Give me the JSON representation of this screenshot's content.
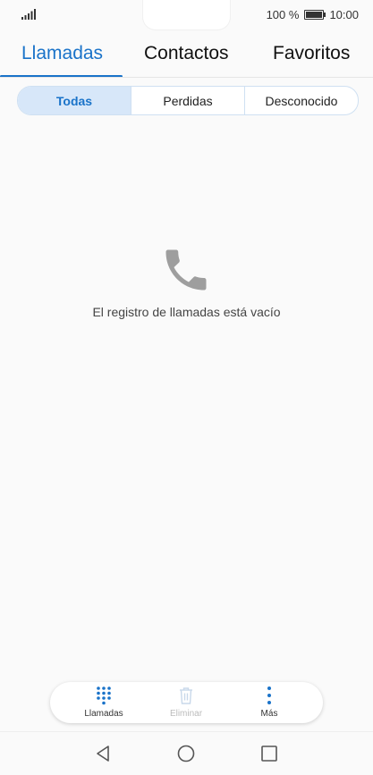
{
  "status": {
    "battery_percent": "100 %",
    "time": "10:00"
  },
  "tabs": [
    {
      "label": "Llamadas",
      "active": true
    },
    {
      "label": "Contactos",
      "active": false
    },
    {
      "label": "Favoritos",
      "active": false
    }
  ],
  "filter": {
    "options": [
      {
        "label": "Todas",
        "active": true
      },
      {
        "label": "Perdidas",
        "active": false
      },
      {
        "label": "Desconocido",
        "active": false
      }
    ]
  },
  "empty_state": {
    "icon": "phone-icon",
    "message": "El registro de llamadas está vacío"
  },
  "actions": [
    {
      "label": "Llamadas",
      "icon": "dialpad-icon",
      "enabled": true
    },
    {
      "label": "Eliminar",
      "icon": "trash-icon",
      "enabled": false
    },
    {
      "label": "Más",
      "icon": "more-vertical-icon",
      "enabled": true
    }
  ],
  "colors": {
    "accent": "#1a73c9",
    "segment_active_bg": "#d7e7f9",
    "disabled": "#bbbbbb"
  }
}
